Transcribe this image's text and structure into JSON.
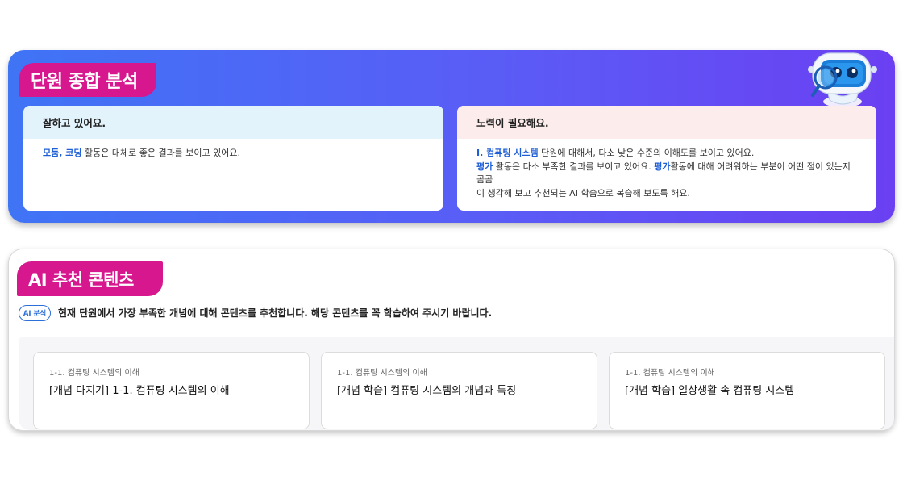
{
  "analysis": {
    "title": "단원 종합 분석",
    "good_card": {
      "heading": "잘하고 있어요.",
      "line1_hl": "모둠, 코딩",
      "line1_rest": " 활동은 대체로 좋은 결과를 보이고 있어요."
    },
    "bad_card": {
      "heading": "노력이 필요해요.",
      "line1_hl": "I. 컴퓨팅 시스템",
      "line1_rest": " 단원에 대해서, 다소 낮은 수준의 이해도를 보이고 있어요.",
      "line2_hl1": "평가",
      "line2_mid": " 활동은 다소 부족한 결과를 보이고 있어요. ",
      "line2_hl2": "평가",
      "line2_rest": "활동에 대해 어려워하는 부분이 어떤 점이 있는지 곰곰",
      "line3": "이 생각해 보고 추천되는 AI 학습으로 복습해 보도록 해요."
    }
  },
  "recommend": {
    "title": "AI 추천 콘텐츠",
    "badge": "AI 분석",
    "message": "현재 단원에서 가장 부족한 개념에 대해 콘텐츠를 추천합니다. 해당 콘텐츠를 꼭 학습하여 주시기 바랍니다.",
    "cards": [
      {
        "sub": "1-1. 컴퓨팅 시스템의 이해",
        "title": "[개념 다지기] 1-1. 컴퓨팅 시스템의 이해"
      },
      {
        "sub": "1-1. 컴퓨팅 시스템의 이해",
        "title": "[개념 학습] 컴퓨팅 시스템의 개념과 특징"
      },
      {
        "sub": "1-1. 컴퓨팅 시스템의 이해",
        "title": "[개념 학습] 일상생활 속 컴퓨팅 시스템"
      }
    ]
  },
  "colors": {
    "accent_pink": "#d6178e",
    "highlight_blue": "#1f5fd6",
    "gradient_start": "#3f74f5",
    "gradient_end": "#6b40f2"
  },
  "icons": {
    "mascot": "robot-mascot-icon"
  }
}
